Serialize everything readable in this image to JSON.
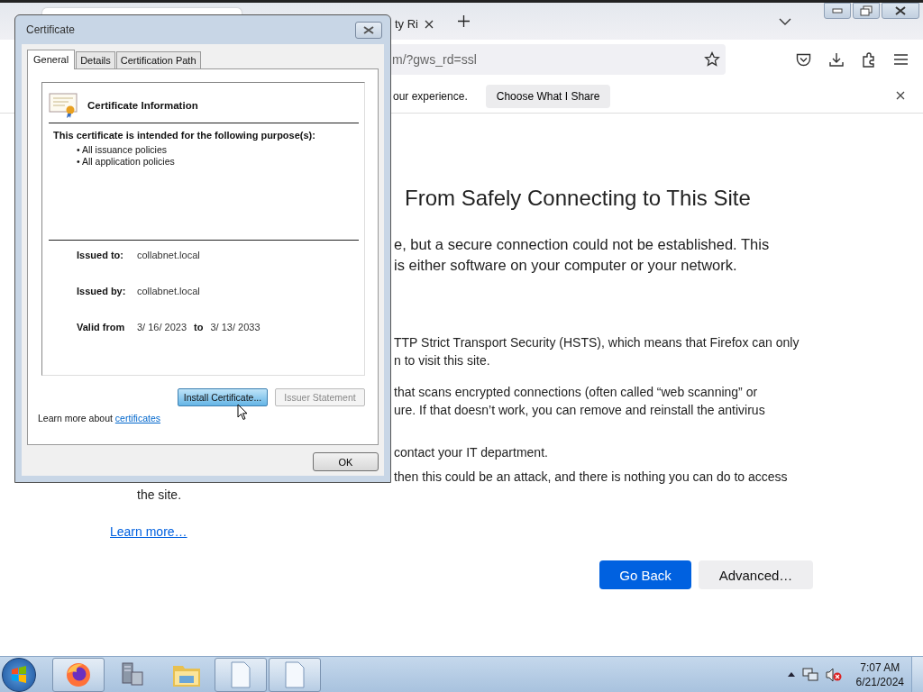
{
  "browser": {
    "tabs": [
      {
        "selected": true
      },
      {
        "label": "ty Ri",
        "selected": false
      }
    ],
    "url": "m/?gws_rd=ssl",
    "notification": {
      "text": "our experience.",
      "button": "Choose What I Share"
    },
    "page": {
      "heading": "From Safely Connecting to This Site",
      "intro": [
        "e, but a secure connection could not be established. This",
        "is either software on your computer or your network."
      ],
      "paragraphs": [
        {
          "lines": [
            {
              "text": "TTP Strict Transport Security (HSTS), which means that Firefox can only",
              "kind": "cut"
            },
            {
              "text": "n to visit this site.",
              "kind": "cut"
            }
          ]
        },
        {
          "lines": [
            {
              "text": "that scans encrypted connections (often called “web scanning” or",
              "kind": "cut"
            },
            {
              "text": "ure. If that doesn’t work, you can remove and reinstall the antivirus",
              "kind": "cut"
            }
          ]
        },
        {
          "lines": [
            {
              "text": "contact your IT department.",
              "kind": "cut"
            }
          ]
        },
        {
          "lines": [
            {
              "text": "then this could be an attack, and there is nothing you can do to access",
              "kind": "cut"
            },
            {
              "text": "the site.",
              "kind": "full"
            }
          ]
        }
      ],
      "learn_more": "Learn more…",
      "buttons": [
        {
          "label": "Go Back",
          "kind": "primary"
        },
        {
          "label": "Advanced…",
          "kind": "secondary"
        }
      ]
    }
  },
  "dialog": {
    "title": "Certificate",
    "tabs": [
      {
        "label": "General",
        "selected": true
      },
      {
        "label": "Details",
        "selected": false
      },
      {
        "label": "Certification Path",
        "selected": false
      }
    ],
    "info_title": "Certificate Information",
    "purpose": "This certificate is intended for the following purpose(s):",
    "policies": [
      "• All issuance policies",
      "• All application policies"
    ],
    "issued_to": {
      "label": "Issued to:",
      "value": "collabnet.local"
    },
    "issued_by": {
      "label": "Issued by:",
      "value": "collabnet.local"
    },
    "valid": {
      "label": "Valid from",
      "from": "3/ 16/ 2023",
      "to_label": "to",
      "to": "3/ 13/ 2033"
    },
    "buttons": [
      {
        "label": "Install Certificate...",
        "disabled": false
      },
      {
        "label": "Issuer Statement",
        "disabled": true
      }
    ],
    "learn_text": "Learn more about",
    "learn_link": "certificates",
    "ok": "OK"
  },
  "taskbar": {
    "time": "7:07 AM",
    "date": "6/21/2024"
  }
}
